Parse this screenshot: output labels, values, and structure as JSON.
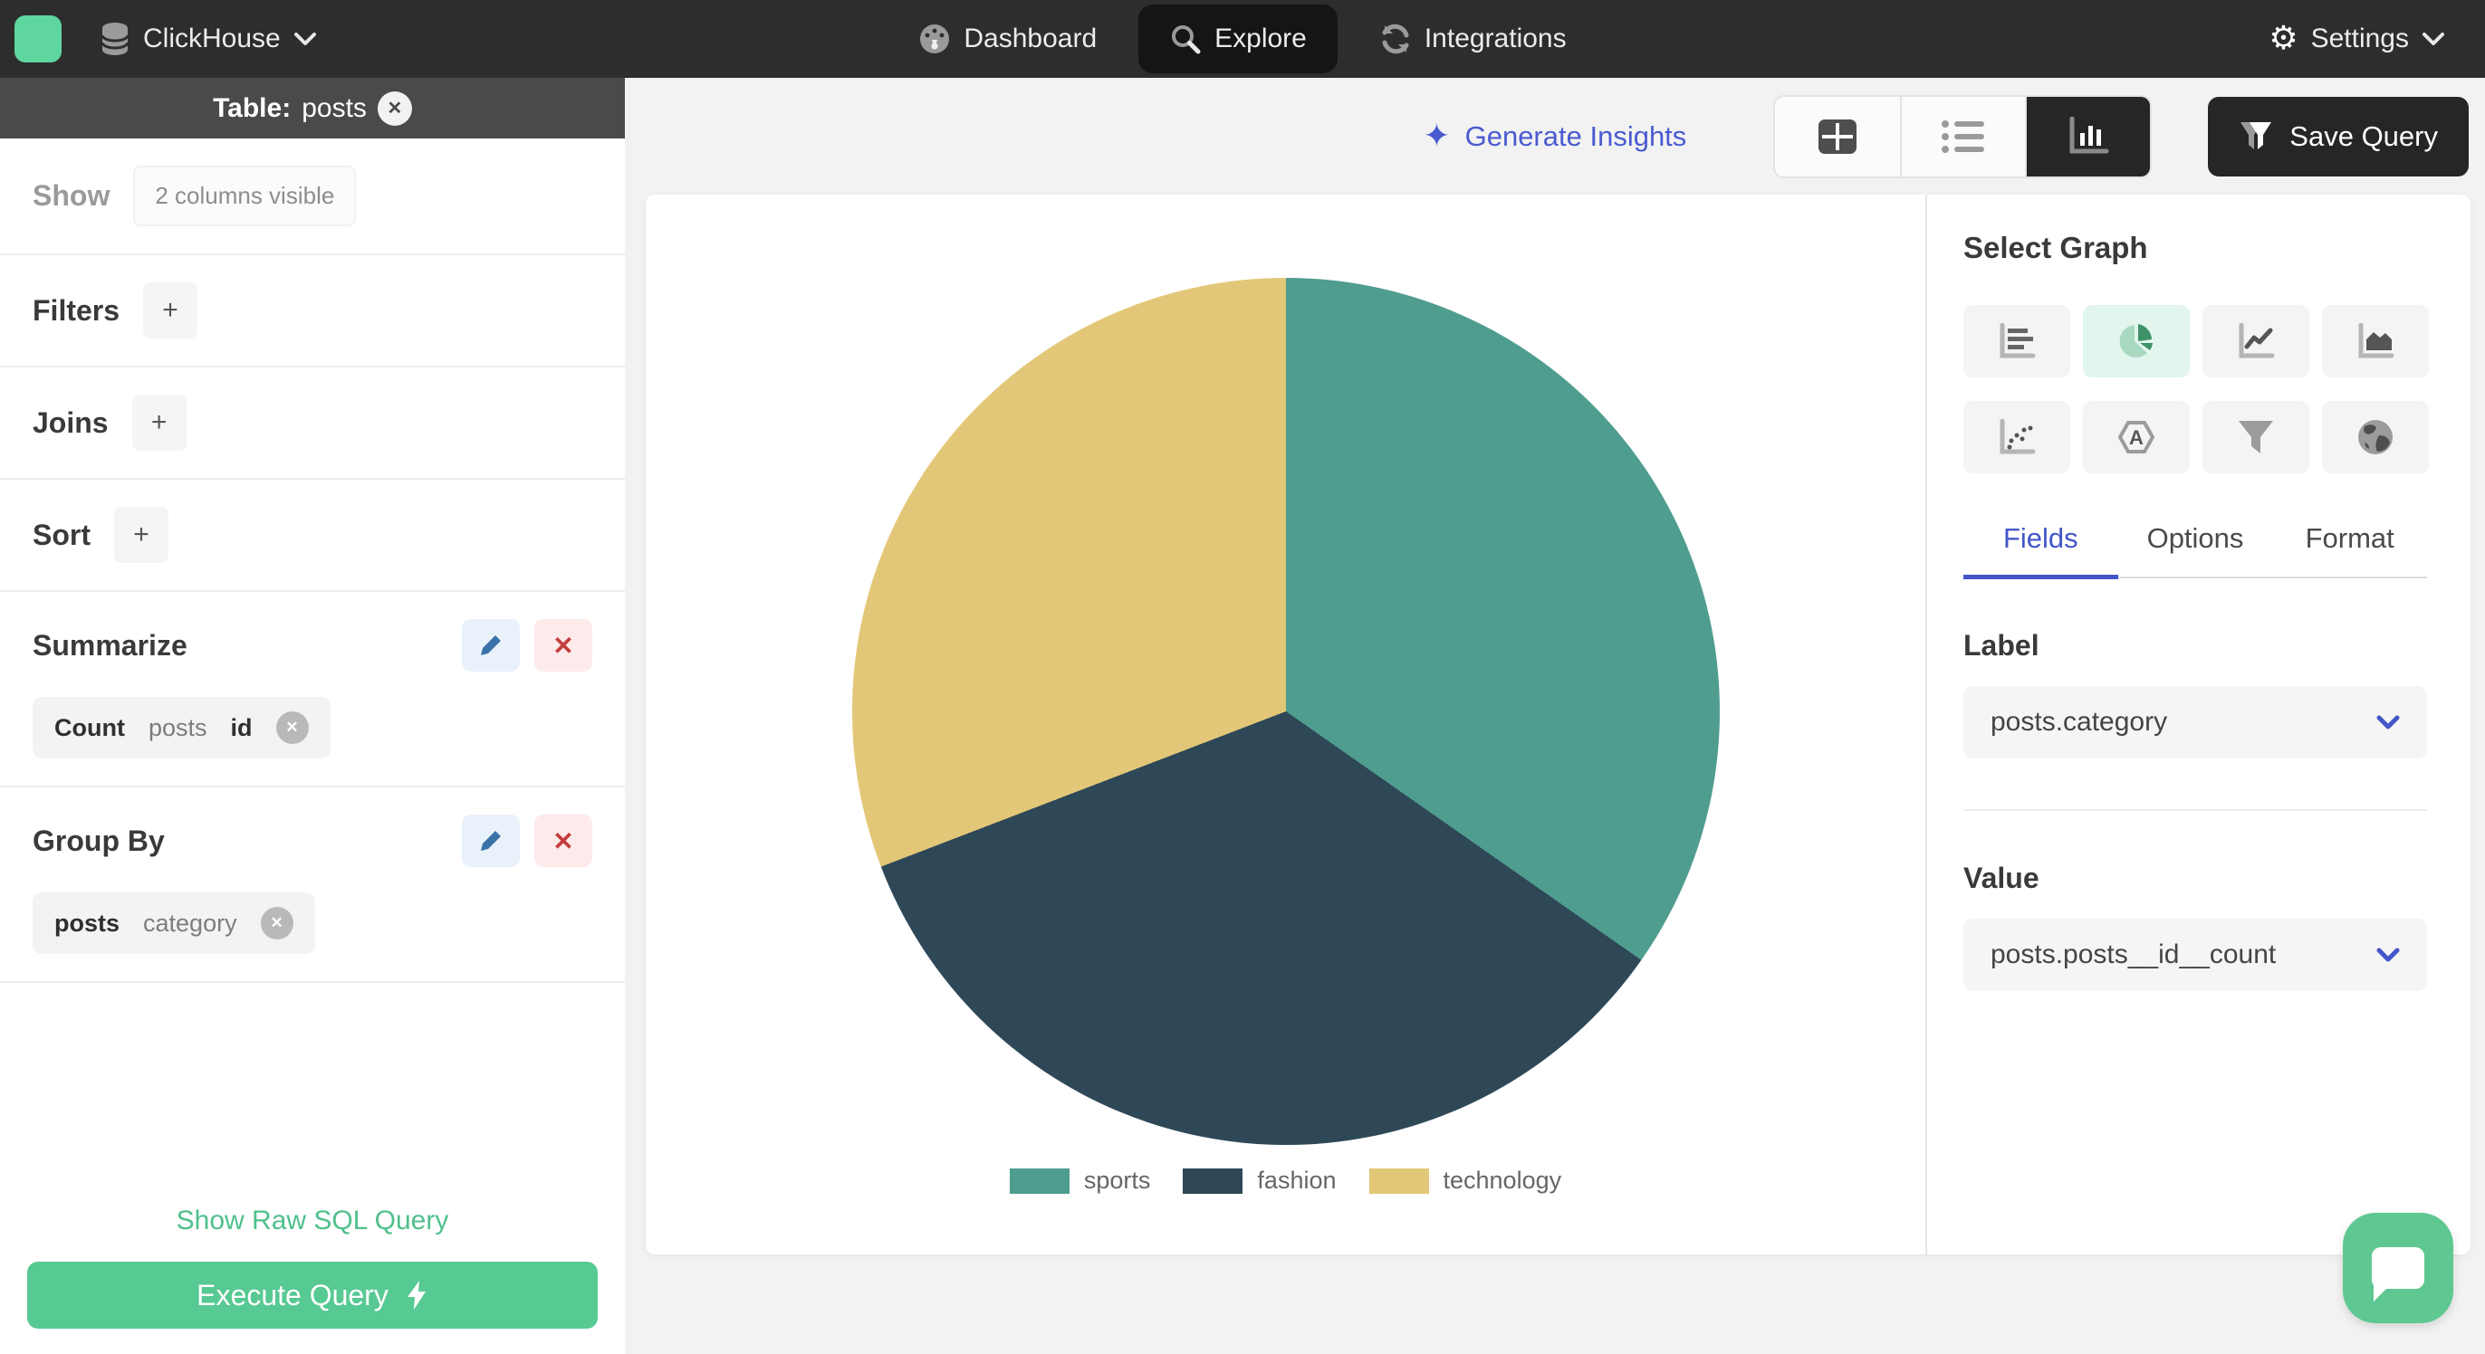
{
  "navbar": {
    "brand": "ClickHouse",
    "items": [
      {
        "label": "Dashboard",
        "active": false
      },
      {
        "label": "Explore",
        "active": true
      },
      {
        "label": "Integrations",
        "active": false
      }
    ],
    "settings_label": "Settings"
  },
  "sidebar": {
    "table_bar": {
      "prefix": "Table:",
      "table_name": "posts"
    },
    "show": {
      "label": "Show",
      "badge": "2 columns visible"
    },
    "filters": {
      "label": "Filters",
      "add_label": "+"
    },
    "joins": {
      "label": "Joins",
      "add_label": "+"
    },
    "sort": {
      "label": "Sort",
      "add_label": "+"
    },
    "summarize": {
      "label": "Summarize",
      "chip": {
        "agg": "Count",
        "table": "posts",
        "column": "id"
      }
    },
    "group_by": {
      "label": "Group By",
      "chip": {
        "table": "posts",
        "column": "category"
      }
    },
    "raw_sql_link": "Show Raw SQL Query",
    "execute_button": "Execute Query"
  },
  "toolbar": {
    "generate_insights": "Generate Insights",
    "save_query": "Save Query",
    "view_modes": [
      "table",
      "list",
      "chart"
    ],
    "active_view": "chart"
  },
  "graph_panel": {
    "title": "Select Graph",
    "graph_types": [
      "bar",
      "pie",
      "line",
      "area",
      "scatter",
      "radar",
      "funnel",
      "geo"
    ],
    "active_graph": "pie",
    "tabs": [
      {
        "label": "Fields",
        "active": true
      },
      {
        "label": "Options",
        "active": false
      },
      {
        "label": "Format",
        "active": false
      }
    ],
    "label_field": {
      "label": "Label",
      "value": "posts.category"
    },
    "value_field": {
      "label": "Value",
      "value": "posts.posts__id__count"
    }
  },
  "chart_data": {
    "type": "pie",
    "title": "",
    "categories": [
      "sports",
      "fashion",
      "technology"
    ],
    "values_percent": [
      34.7,
      34.4,
      30.9
    ],
    "slice_angles_deg": [
      [
        0,
        125
      ],
      [
        125,
        249
      ],
      [
        249,
        360
      ]
    ],
    "colors": {
      "sports": "#4f9d8f",
      "fashion": "#2e4857",
      "technology": "#e3c778"
    },
    "legend_position": "bottom",
    "note": "no numeric labels shown in chart; percentages estimated from slice angles"
  },
  "colors": {
    "navbar_bg": "#2d2d2d",
    "table_bar_bg": "#4a4a4a",
    "accent_green": "#57c993",
    "link_green": "#50c08c",
    "accent_indigo": "#4a5bd0",
    "tab_blue": "#4356c9",
    "active_dark": "#262626",
    "active_mint": "#e2f6ee",
    "edit_blue": "#3a72a8",
    "delete_red": "#c43c3c",
    "fab_green": "#5fc892"
  }
}
